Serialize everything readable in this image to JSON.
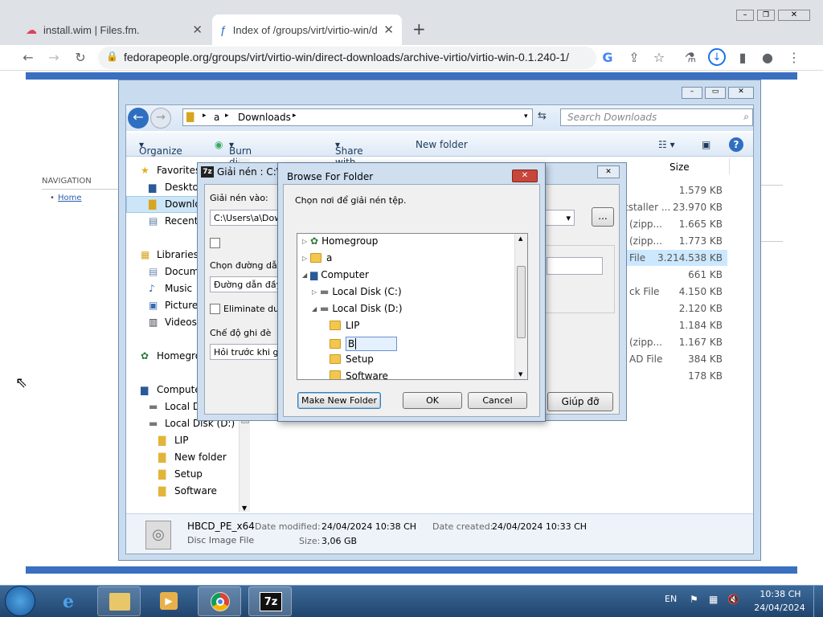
{
  "browser": {
    "tabs": [
      {
        "title": "install.wim | Files.fm."
      },
      {
        "title": "Index of /groups/virt/virtio-win/d"
      }
    ],
    "url": "fedorapeople.org/groups/virt/virtio-win/direct-downloads/archive-virtio/virtio-win-0.1.240-1/"
  },
  "page": {
    "nav_heading": "NAVIGATION",
    "nav_home": "Home"
  },
  "explorer": {
    "breadcrumb": [
      "a",
      "Downloads"
    ],
    "search_placeholder": "Search Downloads",
    "toolbar": {
      "organize": "Organize",
      "burn": "Burn disc image",
      "share": "Share with",
      "new_folder": "New folder"
    },
    "column_size": "Size",
    "nav": {
      "favorites": "Favorites",
      "desktop": "Desktop",
      "downloads": "Downlo",
      "recent": "Recent",
      "libraries": "Libraries",
      "documents": "Docum",
      "music": "Music",
      "pictures": "Pictures",
      "videos": "Videos",
      "homegroup": "Homegro",
      "computer": "Compute",
      "local_c": "Local D",
      "local_d": "Local Disk (D:)",
      "d_items": [
        "LIP",
        "New folder",
        "Setup",
        "Software"
      ]
    },
    "types": [
      "tstaller ...",
      "(zipp...",
      "(zipp...",
      "File",
      "",
      "ck File",
      "",
      "",
      "(zipp...",
      "AD File",
      ""
    ],
    "sizes": [
      "1.579 KB",
      "23.970 KB",
      "1.665 KB",
      "1.773 KB",
      "3.214.538 KB",
      "661 KB",
      "4.150 KB",
      "2.120 KB",
      "1.184 KB",
      "1.167 KB",
      "384 KB",
      "178 KB"
    ],
    "details": {
      "name": "HBCD_PE_x64",
      "type": "Disc Image File",
      "modified_label": "Date modified:",
      "modified": "24/04/2024 10:38 CH",
      "created_label": "Date created:",
      "created": "24/04/2024 10:33 CH",
      "size_label": "Size:",
      "size": "3,06 GB"
    }
  },
  "sevenzip": {
    "title": "Giải nén : C:\\U",
    "extract_to_label": "Giải nén vào:",
    "extract_to_value": "C:\\Users\\a\\Dowr",
    "path_mode_label": "Chọn đường dẫn",
    "path_mode_value": "Đường dẫn đầy đ",
    "eliminate": "Eliminate duplic",
    "overwrite_label": "Chế độ ghi đè",
    "overwrite_value": "Hỏi trước khi ghi c",
    "browse_btn": "...",
    "help_btn": "Giúp đỡ"
  },
  "browse": {
    "title": "Browse For Folder",
    "instruction": "Chọn nơi để giải nén tệp.",
    "tree": [
      "Homegroup",
      "a",
      "Computer",
      "Local Disk (C:)",
      "Local Disk (D:)",
      "LIP",
      "B",
      "Setup",
      "Software"
    ],
    "make_new_folder": "Make New Folder",
    "ok": "OK",
    "cancel": "Cancel"
  },
  "taskbar": {
    "lang": "EN",
    "time": "10:38 CH",
    "date": "24/04/2024"
  }
}
